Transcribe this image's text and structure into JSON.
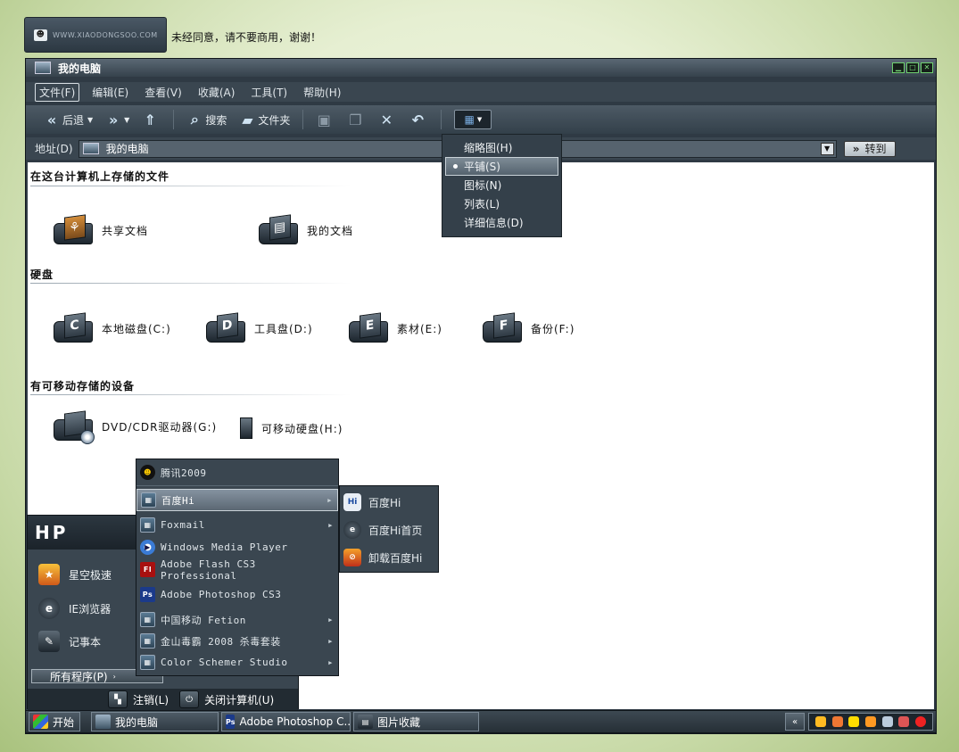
{
  "watermark": {
    "site": "WWW.XIAODONGSOO.COM",
    "notice": "未经同意，请不要商用，谢谢！"
  },
  "window": {
    "title": "我的电脑",
    "controls": [
      "minimize",
      "maximize",
      "close"
    ]
  },
  "menubar": {
    "items": [
      {
        "label": "文件(F)"
      },
      {
        "label": "编辑(E)"
      },
      {
        "label": "查看(V)"
      },
      {
        "label": "收藏(A)"
      },
      {
        "label": "工具(T)"
      },
      {
        "label": "帮助(H)"
      }
    ]
  },
  "toolbar": {
    "back_label": "后退",
    "search_label": "搜索",
    "folders_label": "文件夹"
  },
  "address": {
    "label": "地址(D)",
    "value": "我的电脑",
    "go_label": "转到"
  },
  "view_menu": {
    "items": [
      {
        "label": "缩略图(H)",
        "selected": false
      },
      {
        "label": "平铺(S)",
        "selected": true
      },
      {
        "label": "图标(N)",
        "selected": false
      },
      {
        "label": "列表(L)",
        "selected": false
      },
      {
        "label": "详细信息(D)",
        "selected": false
      }
    ]
  },
  "sections": {
    "stored_files": {
      "title": "在这台计算机上存储的文件",
      "items": [
        {
          "label": "共享文档",
          "icon": "shared-folder-icon"
        },
        {
          "label": "我的文档",
          "icon": "my-documents-icon"
        }
      ]
    },
    "hard_disks": {
      "title": "硬盘",
      "items": [
        {
          "label": "本地磁盘(C:)",
          "letter": "C"
        },
        {
          "label": "工具盘(D:)",
          "letter": "D"
        },
        {
          "label": "素材(E:)",
          "letter": "E"
        },
        {
          "label": "备份(F:)",
          "letter": "F"
        }
      ]
    },
    "removable": {
      "title": "有可移动存储的设备",
      "items": [
        {
          "label": "DVD/CDR驱动器(G:)"
        },
        {
          "label": "可移动硬盘(H:)"
        }
      ]
    }
  },
  "start_menu": {
    "header": "HP",
    "items": [
      {
        "label": "星空极速"
      },
      {
        "label": "IE浏览器"
      },
      {
        "label": "记事本"
      }
    ],
    "all_programs": "所有程序(P)",
    "logoff": "注销(L)",
    "shutdown": "关闭计算机(U)"
  },
  "programs_menu": {
    "items": [
      {
        "label": "腾讯2009",
        "submenu": false
      },
      {
        "label": "百度Hi",
        "submenu": true,
        "selected": true
      },
      {
        "label": "Foxmail",
        "submenu": true
      },
      {
        "label": "Windows Media Player",
        "submenu": false
      },
      {
        "label": "Adobe Flash CS3 Professional",
        "submenu": false
      },
      {
        "label": "Adobe Photoshop CS3",
        "submenu": false
      },
      {
        "label": "中国移动 Fetion",
        "submenu": true
      },
      {
        "label": "金山毒霸 2008 杀毒套装",
        "submenu": true
      },
      {
        "label": "Color Schemer Studio",
        "submenu": true
      }
    ]
  },
  "baidu_submenu": {
    "items": [
      {
        "label": "百度Hi"
      },
      {
        "label": "百度Hi首页"
      },
      {
        "label": "卸载百度Hi"
      }
    ]
  },
  "taskbar": {
    "start_label": "开始",
    "tasks": [
      {
        "label": "我的电脑"
      },
      {
        "label": "Adobe Photoshop C..."
      },
      {
        "label": "图片收藏"
      }
    ],
    "tray_toggle": "«"
  },
  "colors": {
    "window_bg": "#2f3a44",
    "content_bg": "#ffffff",
    "menu_bg": "#3a4650",
    "highlight": "#7d8b96"
  }
}
